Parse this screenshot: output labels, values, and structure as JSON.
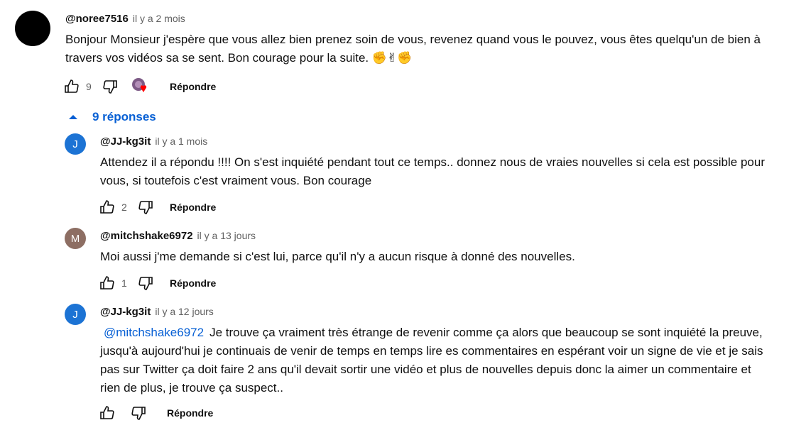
{
  "comment": {
    "author": "@noree7516",
    "time": "il y a 2 mois",
    "text": "Bonjour Monsieur j'espère que vous allez bien prenez soin de vous, revenez quand vous le pouvez, vous êtes quelqu'un de bien à travers vos vidéos sa se sent. Bon courage pour la suite. ✊✌✊",
    "likes": "9",
    "reply_label": "Répondre",
    "avatar_color": "#000000"
  },
  "replies_toggle": {
    "label": "9 réponses"
  },
  "replies": [
    {
      "author": "@JJ-kg3it",
      "time": "il y a 1 mois",
      "avatar_letter": "J",
      "avatar_color": "#1c73d4",
      "text": "Attendez il a répondu !!!! On s'est inquiété pendant tout ce temps.. donnez nous de vraies nouvelles si cela est possible pour vous, si toutefois c'est vraiment vous. Bon courage",
      "likes": "2",
      "reply_label": "Répondre"
    },
    {
      "author": "@mitchshake6972",
      "time": "il y a 13 jours",
      "avatar_letter": "M",
      "avatar_color": "#8d6e63",
      "text": "Moi aussi j'me demande si c'est lui, parce qu'il n'y a aucun risque à donné des nouvelles.",
      "likes": "1",
      "reply_label": "Répondre"
    },
    {
      "author": "@JJ-kg3it",
      "time": "il y a 12 jours",
      "avatar_letter": "J",
      "avatar_color": "#1c73d4",
      "mention": "@mitchshake6972",
      "text": "Je trouve ça vraiment très étrange de revenir comme ça alors que beaucoup se sont inquiété la preuve, jusqu'à aujourd'hui je continuais de venir de temps en temps lire es commentaires en espérant voir un signe de vie et je sais pas sur Twitter ça doit faire 2 ans qu'il devait sortir une vidéo et plus de nouvelles depuis donc la aimer un commentaire et rien de plus, je trouve ça suspect..",
      "likes": "",
      "reply_label": "Répondre"
    }
  ],
  "colors": {
    "accent": "#065fd4",
    "heart": "#ff0000"
  },
  "icons": [
    "thumb-up-icon",
    "thumb-down-icon",
    "chevron-up-icon",
    "heart-icon"
  ]
}
